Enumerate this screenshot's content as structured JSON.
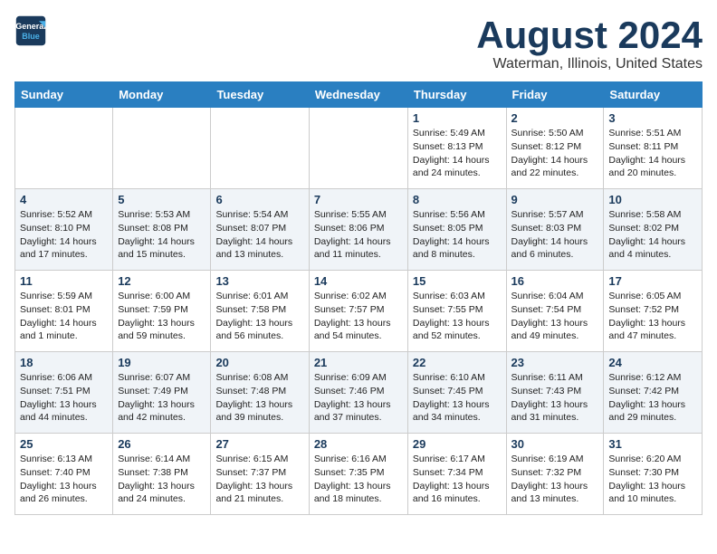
{
  "header": {
    "logo_line1": "General",
    "logo_line2": "Blue",
    "month_title": "August 2024",
    "location": "Waterman, Illinois, United States"
  },
  "weekdays": [
    "Sunday",
    "Monday",
    "Tuesday",
    "Wednesday",
    "Thursday",
    "Friday",
    "Saturday"
  ],
  "weeks": [
    [
      {
        "day": "",
        "sunrise": "",
        "sunset": "",
        "daylight": ""
      },
      {
        "day": "",
        "sunrise": "",
        "sunset": "",
        "daylight": ""
      },
      {
        "day": "",
        "sunrise": "",
        "sunset": "",
        "daylight": ""
      },
      {
        "day": "",
        "sunrise": "",
        "sunset": "",
        "daylight": ""
      },
      {
        "day": "1",
        "sunrise": "Sunrise: 5:49 AM",
        "sunset": "Sunset: 8:13 PM",
        "daylight": "Daylight: 14 hours and 24 minutes."
      },
      {
        "day": "2",
        "sunrise": "Sunrise: 5:50 AM",
        "sunset": "Sunset: 8:12 PM",
        "daylight": "Daylight: 14 hours and 22 minutes."
      },
      {
        "day": "3",
        "sunrise": "Sunrise: 5:51 AM",
        "sunset": "Sunset: 8:11 PM",
        "daylight": "Daylight: 14 hours and 20 minutes."
      }
    ],
    [
      {
        "day": "4",
        "sunrise": "Sunrise: 5:52 AM",
        "sunset": "Sunset: 8:10 PM",
        "daylight": "Daylight: 14 hours and 17 minutes."
      },
      {
        "day": "5",
        "sunrise": "Sunrise: 5:53 AM",
        "sunset": "Sunset: 8:08 PM",
        "daylight": "Daylight: 14 hours and 15 minutes."
      },
      {
        "day": "6",
        "sunrise": "Sunrise: 5:54 AM",
        "sunset": "Sunset: 8:07 PM",
        "daylight": "Daylight: 14 hours and 13 minutes."
      },
      {
        "day": "7",
        "sunrise": "Sunrise: 5:55 AM",
        "sunset": "Sunset: 8:06 PM",
        "daylight": "Daylight: 14 hours and 11 minutes."
      },
      {
        "day": "8",
        "sunrise": "Sunrise: 5:56 AM",
        "sunset": "Sunset: 8:05 PM",
        "daylight": "Daylight: 14 hours and 8 minutes."
      },
      {
        "day": "9",
        "sunrise": "Sunrise: 5:57 AM",
        "sunset": "Sunset: 8:03 PM",
        "daylight": "Daylight: 14 hours and 6 minutes."
      },
      {
        "day": "10",
        "sunrise": "Sunrise: 5:58 AM",
        "sunset": "Sunset: 8:02 PM",
        "daylight": "Daylight: 14 hours and 4 minutes."
      }
    ],
    [
      {
        "day": "11",
        "sunrise": "Sunrise: 5:59 AM",
        "sunset": "Sunset: 8:01 PM",
        "daylight": "Daylight: 14 hours and 1 minute."
      },
      {
        "day": "12",
        "sunrise": "Sunrise: 6:00 AM",
        "sunset": "Sunset: 7:59 PM",
        "daylight": "Daylight: 13 hours and 59 minutes."
      },
      {
        "day": "13",
        "sunrise": "Sunrise: 6:01 AM",
        "sunset": "Sunset: 7:58 PM",
        "daylight": "Daylight: 13 hours and 56 minutes."
      },
      {
        "day": "14",
        "sunrise": "Sunrise: 6:02 AM",
        "sunset": "Sunset: 7:57 PM",
        "daylight": "Daylight: 13 hours and 54 minutes."
      },
      {
        "day": "15",
        "sunrise": "Sunrise: 6:03 AM",
        "sunset": "Sunset: 7:55 PM",
        "daylight": "Daylight: 13 hours and 52 minutes."
      },
      {
        "day": "16",
        "sunrise": "Sunrise: 6:04 AM",
        "sunset": "Sunset: 7:54 PM",
        "daylight": "Daylight: 13 hours and 49 minutes."
      },
      {
        "day": "17",
        "sunrise": "Sunrise: 6:05 AM",
        "sunset": "Sunset: 7:52 PM",
        "daylight": "Daylight: 13 hours and 47 minutes."
      }
    ],
    [
      {
        "day": "18",
        "sunrise": "Sunrise: 6:06 AM",
        "sunset": "Sunset: 7:51 PM",
        "daylight": "Daylight: 13 hours and 44 minutes."
      },
      {
        "day": "19",
        "sunrise": "Sunrise: 6:07 AM",
        "sunset": "Sunset: 7:49 PM",
        "daylight": "Daylight: 13 hours and 42 minutes."
      },
      {
        "day": "20",
        "sunrise": "Sunrise: 6:08 AM",
        "sunset": "Sunset: 7:48 PM",
        "daylight": "Daylight: 13 hours and 39 minutes."
      },
      {
        "day": "21",
        "sunrise": "Sunrise: 6:09 AM",
        "sunset": "Sunset: 7:46 PM",
        "daylight": "Daylight: 13 hours and 37 minutes."
      },
      {
        "day": "22",
        "sunrise": "Sunrise: 6:10 AM",
        "sunset": "Sunset: 7:45 PM",
        "daylight": "Daylight: 13 hours and 34 minutes."
      },
      {
        "day": "23",
        "sunrise": "Sunrise: 6:11 AM",
        "sunset": "Sunset: 7:43 PM",
        "daylight": "Daylight: 13 hours and 31 minutes."
      },
      {
        "day": "24",
        "sunrise": "Sunrise: 6:12 AM",
        "sunset": "Sunset: 7:42 PM",
        "daylight": "Daylight: 13 hours and 29 minutes."
      }
    ],
    [
      {
        "day": "25",
        "sunrise": "Sunrise: 6:13 AM",
        "sunset": "Sunset: 7:40 PM",
        "daylight": "Daylight: 13 hours and 26 minutes."
      },
      {
        "day": "26",
        "sunrise": "Sunrise: 6:14 AM",
        "sunset": "Sunset: 7:38 PM",
        "daylight": "Daylight: 13 hours and 24 minutes."
      },
      {
        "day": "27",
        "sunrise": "Sunrise: 6:15 AM",
        "sunset": "Sunset: 7:37 PM",
        "daylight": "Daylight: 13 hours and 21 minutes."
      },
      {
        "day": "28",
        "sunrise": "Sunrise: 6:16 AM",
        "sunset": "Sunset: 7:35 PM",
        "daylight": "Daylight: 13 hours and 18 minutes."
      },
      {
        "day": "29",
        "sunrise": "Sunrise: 6:17 AM",
        "sunset": "Sunset: 7:34 PM",
        "daylight": "Daylight: 13 hours and 16 minutes."
      },
      {
        "day": "30",
        "sunrise": "Sunrise: 6:19 AM",
        "sunset": "Sunset: 7:32 PM",
        "daylight": "Daylight: 13 hours and 13 minutes."
      },
      {
        "day": "31",
        "sunrise": "Sunrise: 6:20 AM",
        "sunset": "Sunset: 7:30 PM",
        "daylight": "Daylight: 13 hours and 10 minutes."
      }
    ]
  ]
}
